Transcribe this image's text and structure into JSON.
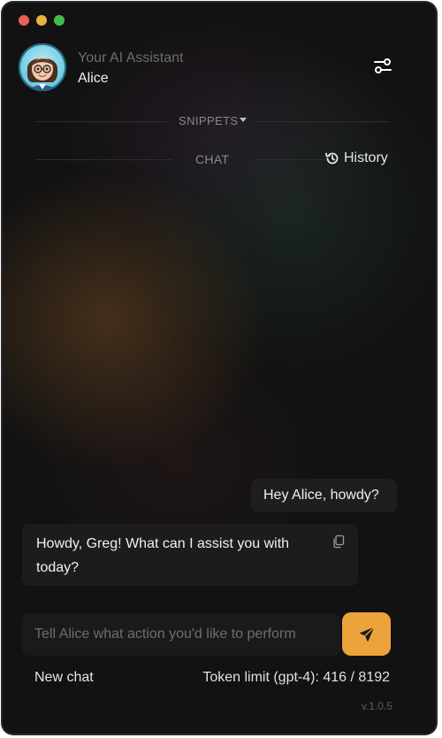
{
  "window": {
    "controls": [
      "close",
      "minimize",
      "zoom"
    ]
  },
  "header": {
    "subtitle": "Your AI Assistant",
    "assistant_name": "Alice",
    "settings_icon": "sliders-icon"
  },
  "nav": {
    "snippets_label": "SNIPPETS",
    "chat_label": "CHAT",
    "history_label": "History"
  },
  "messages": [
    {
      "role": "user",
      "text": "Hey Alice, howdy?"
    },
    {
      "role": "assistant",
      "text": "Howdy, Greg! What can I assist you with today?"
    }
  ],
  "composer": {
    "placeholder": "Tell Alice what action you'd like to perform",
    "value": "",
    "send_icon": "paper-plane-icon"
  },
  "footer": {
    "new_chat_label": "New chat",
    "token_limit": "Token limit (gpt-4): 416 / 8192",
    "version": "v.1.0.5"
  },
  "colors": {
    "accent": "#eda33b",
    "background": "#121212",
    "bubble": "#1e1e1e"
  }
}
